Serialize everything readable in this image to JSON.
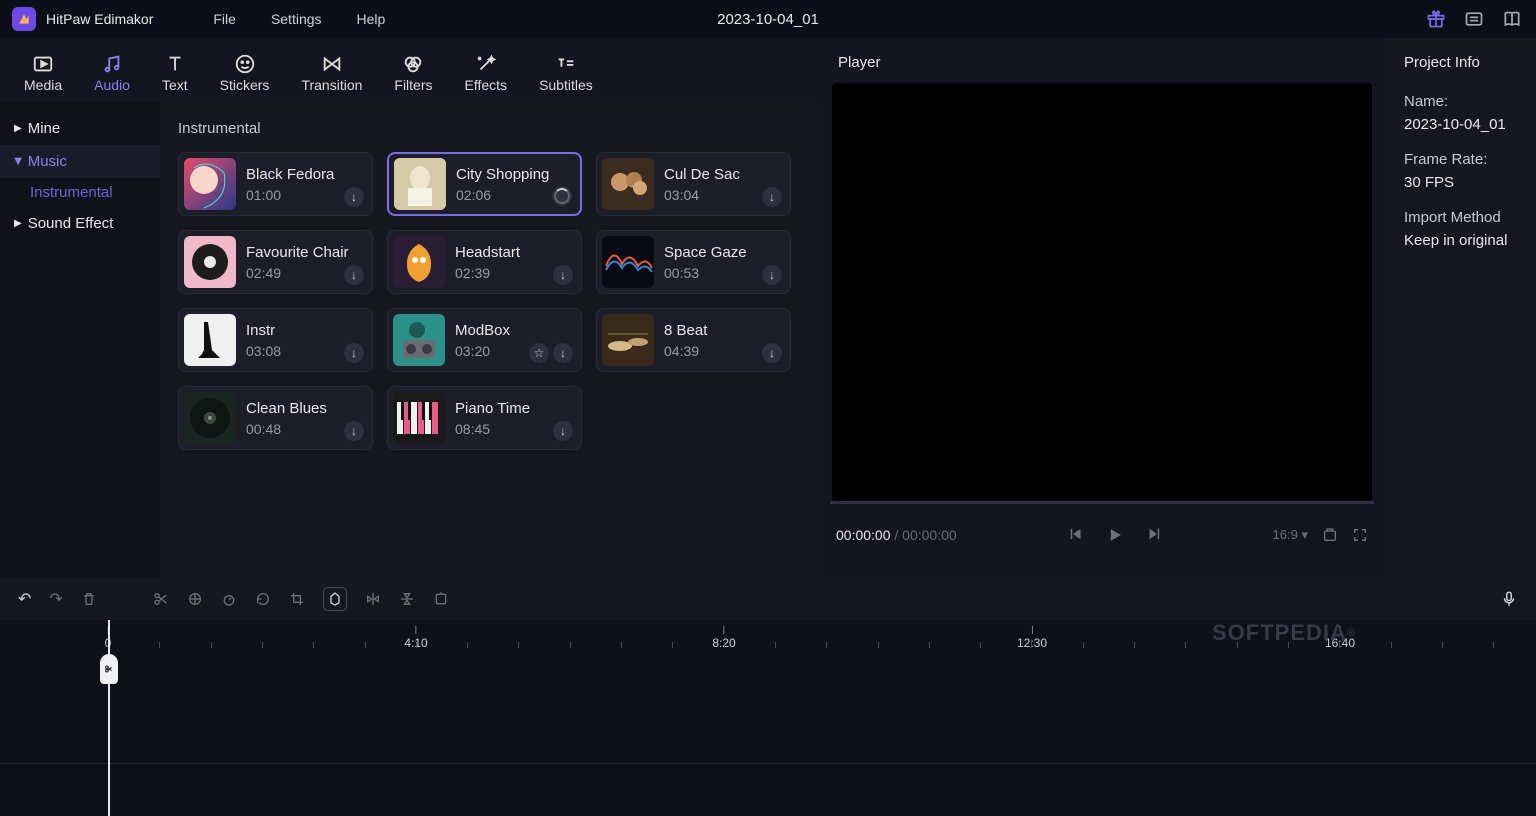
{
  "app": {
    "name": "HitPaw Edimakor",
    "project_title": "2023-10-04_01"
  },
  "menu": {
    "file": "File",
    "settings": "Settings",
    "help": "Help"
  },
  "tabs": [
    {
      "label": "Media"
    },
    {
      "label": "Audio"
    },
    {
      "label": "Text"
    },
    {
      "label": "Stickers"
    },
    {
      "label": "Transition"
    },
    {
      "label": "Filters"
    },
    {
      "label": "Effects"
    },
    {
      "label": "Subtitles"
    }
  ],
  "sidebar": {
    "mine": "Mine",
    "music": "Music",
    "instrumental": "Instrumental",
    "sound_effect": "Sound Effect"
  },
  "library": {
    "heading": "Instrumental",
    "items": [
      {
        "title": "Black Fedora",
        "dur": "01:00"
      },
      {
        "title": "City Shopping",
        "dur": "02:06"
      },
      {
        "title": "Cul De Sac",
        "dur": "03:04"
      },
      {
        "title": "Favourite Chair",
        "dur": "02:49"
      },
      {
        "title": "Headstart",
        "dur": "02:39"
      },
      {
        "title": "Space Gaze",
        "dur": "00:53"
      },
      {
        "title": "Instr",
        "dur": "03:08"
      },
      {
        "title": "ModBox",
        "dur": "03:20"
      },
      {
        "title": "8 Beat",
        "dur": "04:39"
      },
      {
        "title": "Clean Blues",
        "dur": "00:48"
      },
      {
        "title": "Piano Time",
        "dur": "08:45"
      }
    ]
  },
  "player": {
    "title": "Player",
    "time_current": "00:00:00",
    "time_total": "00:00:00",
    "aspect": "16:9"
  },
  "info": {
    "heading": "Project Info",
    "name_label": "Name:",
    "name_value": "2023-10-04_01",
    "fps_label": "Frame Rate:",
    "fps_value": "30 FPS",
    "import_label": "Import Method",
    "import_value": "Keep in original"
  },
  "ruler": [
    "0",
    "4:10",
    "8:20",
    "12:30",
    "16:40"
  ],
  "watermark": "SOFTPEDIA"
}
